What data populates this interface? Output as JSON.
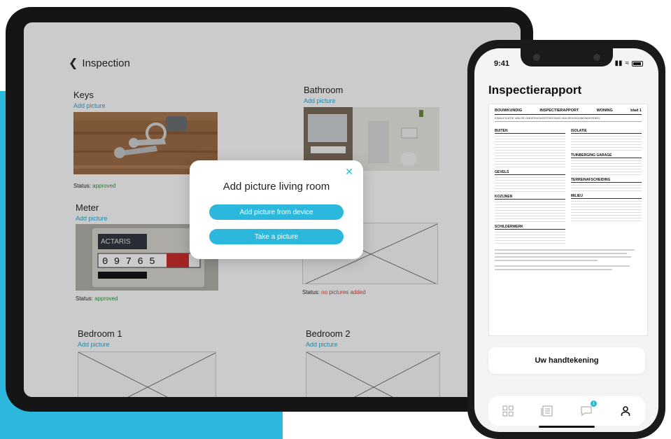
{
  "colors": {
    "accent": "#2bb8dc",
    "approved": "#2e9a3a",
    "no_pictures": "#d63a3a"
  },
  "tablet": {
    "header": {
      "title": "Inspection"
    },
    "cards": [
      {
        "name": "Keys",
        "link": "Add picture",
        "status_label": "Status:",
        "status_value": "approved"
      },
      {
        "name": "Bathroom",
        "link": "Add picture"
      },
      {
        "name": "Meter",
        "link": "Add picture",
        "status_label": "Status:",
        "status_value": "approved"
      },
      {
        "name": "",
        "link": "",
        "status_label": "Status:",
        "status_value": "no pictures added"
      },
      {
        "name": "Bedroom 1",
        "link": "Add picture"
      },
      {
        "name": "Bedroom 2",
        "link": "Add picture"
      }
    ],
    "meter_reading": "0 9 7 6 5",
    "meter_brand": "ACTARIS",
    "modal": {
      "title": "Add picture living room",
      "btn_device": "Add picture from device",
      "btn_camera": "Take a picture"
    }
  },
  "phone": {
    "time": "9:41",
    "title": "Inspectierapport",
    "report": {
      "h1": "BOUWKUNDIG",
      "h2": "INSPECTIERAPPORT",
      "h3": "WONING",
      "sheet": "blad 1",
      "sub": "KWALIFICATIE VAN DE ONDERHOUDSTOESTAND VAN EEN BOUWONDERDEEL",
      "left_sections": [
        "BUITEN",
        "GEVELS",
        "KOZIJNEN",
        "SCHILDERWERK"
      ],
      "right_sections": [
        "ISOLATIE",
        "TUINBERGING GARAGE",
        "TERREINAFSCHEIDING",
        "MILIEU"
      ]
    },
    "sign_label": "Uw handtekening",
    "tabs": [
      "grid-icon",
      "document-icon",
      "chat-icon",
      "user-icon"
    ],
    "badge": "1"
  }
}
